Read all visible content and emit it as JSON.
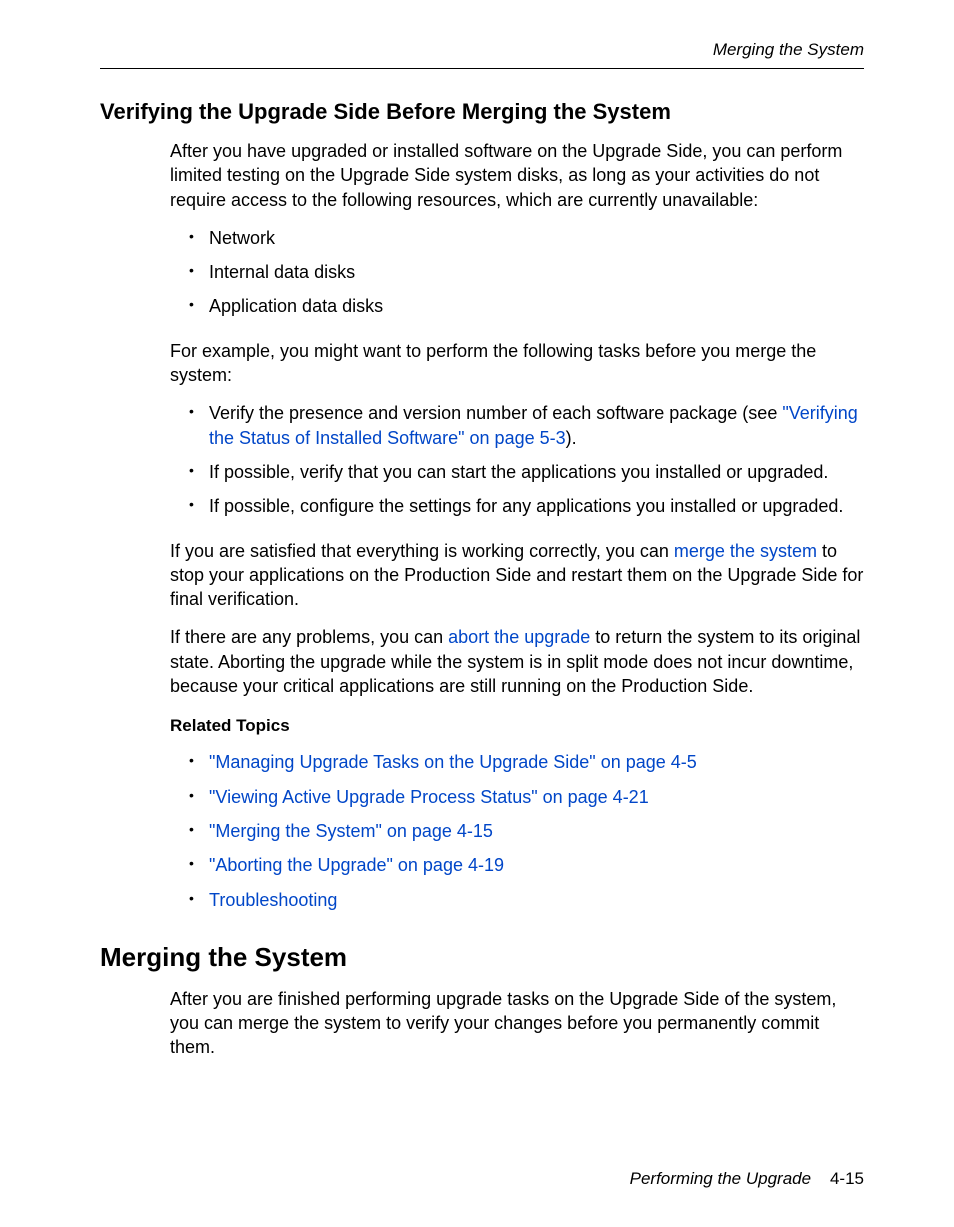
{
  "header": {
    "running_title": "Merging the System"
  },
  "section1": {
    "title": "Verifying the Upgrade Side Before Merging the System",
    "p1": "After you have upgraded or installed software on the Upgrade Side, you can perform limited testing on the Upgrade Side system disks, as long as your activities do not require access to the following resources, which are currently unavailable:",
    "bullets1": [
      "Network",
      "Internal data disks",
      "Application data disks"
    ],
    "p2": "For example, you might want to perform the following tasks before you merge the system:",
    "bullets2": {
      "item1_prefix": "Verify the presence and version number of each software package (see ",
      "item1_link": "\"Verifying the Status of Installed Software\" on page 5-3",
      "item1_suffix": ").",
      "item2": "If possible, verify that you can start the applications you installed or upgraded.",
      "item3": "If possible, configure the settings for any applications you installed or upgraded."
    },
    "p3_prefix": "If you are satisfied that everything is working correctly, you can ",
    "p3_link": "merge the system",
    "p3_suffix": " to stop your applications on the Production Side and restart them on the Upgrade Side for final verification.",
    "p4_prefix": "If there are any problems, you can ",
    "p4_link": "abort the upgrade",
    "p4_suffix": " to return the system to its original state. Aborting the upgrade while the system is in split mode does not incur downtime, because your critical applications are still running on the Production Side.",
    "related_heading": "Related Topics",
    "related": [
      "\"Managing Upgrade Tasks on the Upgrade Side\" on page 4-5",
      "\"Viewing Active Upgrade Process Status\" on page 4-21",
      "\"Merging the System\" on page 4-15",
      "\"Aborting the Upgrade\" on page 4-19",
      "Troubleshooting"
    ]
  },
  "section2": {
    "title": "Merging the System",
    "p1": "After you are finished performing upgrade tasks on the Upgrade Side of the system, you can merge the system to verify your changes before you permanently commit them."
  },
  "footer": {
    "chapter": "Performing the Upgrade",
    "page": "4-15"
  }
}
